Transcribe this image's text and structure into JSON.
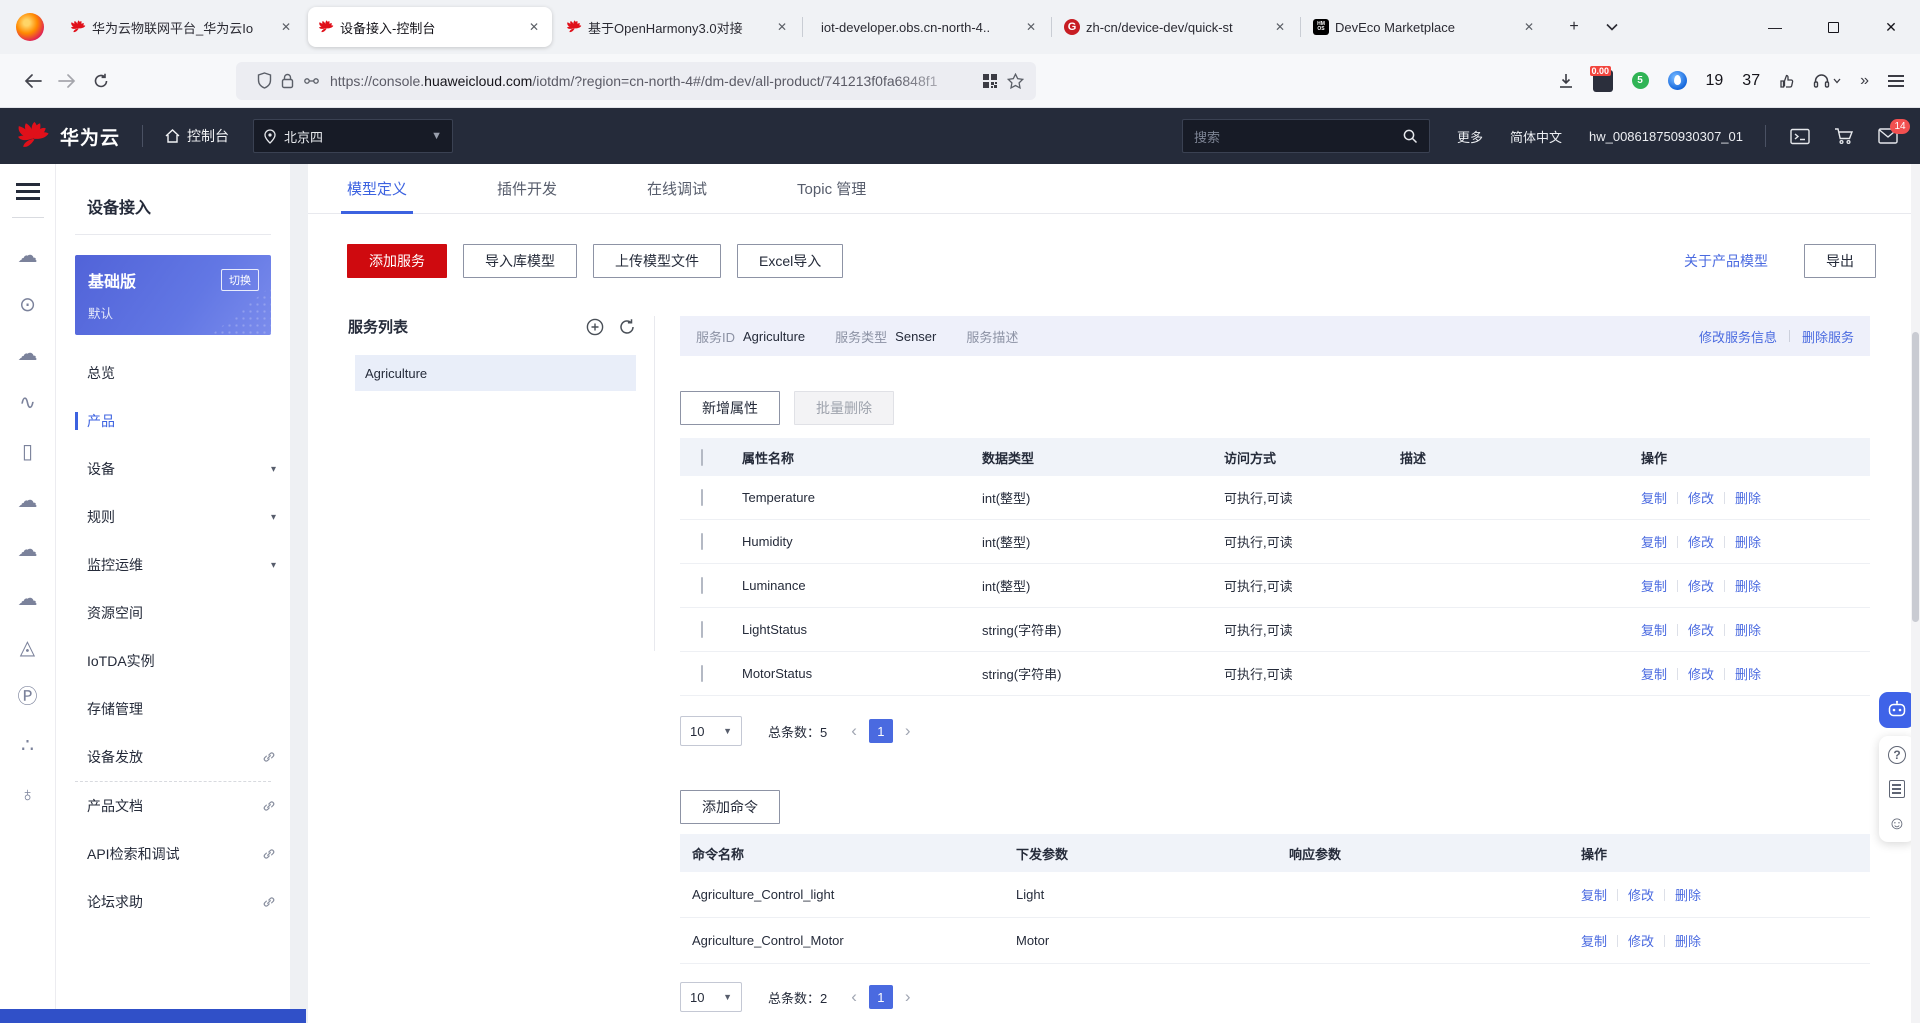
{
  "glyphs": {
    "close": "✕",
    "plus": "+",
    "minus": "—",
    "caret_down": "▾",
    "select_caret": "▼",
    "chevron_left": "‹",
    "chevron_right": "›",
    "more_chevrons": "»",
    "add_circle_plus": "+",
    "smiley": "☺"
  },
  "browser": {
    "tabs": [
      {
        "title": "华为云物联网平台_华为云Io"
      },
      {
        "title": "设备接入-控制台"
      },
      {
        "title": "基于OpenHarmony3.0对接"
      },
      {
        "title": "iot-developer.obs.cn-north-4.."
      },
      {
        "title": "zh-cn/device-dev/quick-st"
      },
      {
        "title": "DevEco Marketplace"
      }
    ],
    "hmos_line1": "HM",
    "hmos_line2": "OS",
    "gitee_letter": "G",
    "url": {
      "prefix": "https://console.",
      "domain": "huaweicloud.com",
      "path": "/iotdm/?region=cn-north-4#/dm-dev/all-product/741213f0fa6848f1"
    },
    "wallet_badge": "0.00",
    "ext_green": "5",
    "ext_counts": [
      "19",
      "37"
    ]
  },
  "console_header": {
    "brand": "华为云",
    "home": "控制台",
    "region": "北京四",
    "search_placeholder": "搜索",
    "more": "更多",
    "lang": "简体中文",
    "account": "hw_008618750930307_01",
    "mail_badge": "14"
  },
  "rail": {
    "icons": [
      {
        "name": "cloud-server-icon",
        "glyph": "☁"
      },
      {
        "name": "cloud-dots-icon",
        "glyph": "⊙"
      },
      {
        "name": "cloud-lines-icon",
        "glyph": "☁"
      },
      {
        "name": "waves-icon",
        "glyph": "∿"
      },
      {
        "name": "device-icon",
        "glyph": "▯"
      },
      {
        "name": "cloud-icon",
        "glyph": "☁"
      },
      {
        "name": "cloud-upload-icon",
        "glyph": "☁"
      },
      {
        "name": "cloud-check-icon",
        "glyph": "☁"
      },
      {
        "name": "drone-icon",
        "glyph": "◬"
      },
      {
        "name": "ip-icon",
        "glyph": "Ⓟ"
      },
      {
        "name": "cluster-icon",
        "glyph": "∴"
      },
      {
        "name": "globe-icon",
        "glyph": "♁"
      }
    ]
  },
  "sidebar": {
    "title": "设备接入",
    "edition": {
      "name": "基础版",
      "switch_label": "切换",
      "subtitle": "默认"
    },
    "items": [
      {
        "label": "总览"
      },
      {
        "label": "产品"
      },
      {
        "label": "设备"
      },
      {
        "label": "规则"
      },
      {
        "label": "监控运维"
      },
      {
        "label": "资源空间"
      },
      {
        "label": "IoTDA实例"
      },
      {
        "label": "存储管理"
      },
      {
        "label": "设备发放"
      },
      {
        "label": "产品文档"
      },
      {
        "label": "API检索和调试"
      },
      {
        "label": "论坛求助"
      }
    ]
  },
  "content": {
    "tabs": [
      {
        "label": "模型定义"
      },
      {
        "label": "插件开发"
      },
      {
        "label": "在线调试"
      },
      {
        "label": "Topic 管理"
      }
    ],
    "toolbar": {
      "add_service": "添加服务",
      "import_model": "导入库模型",
      "upload_model": "上传模型文件",
      "excel_import": "Excel导入",
      "about_link": "关于产品模型",
      "export": "导出"
    },
    "service_list": {
      "title": "服务列表",
      "items": [
        {
          "name": "Agriculture"
        }
      ]
    },
    "service_info": {
      "id_label": "服务ID",
      "id_value": "Agriculture",
      "type_label": "服务类型",
      "type_value": "Senser",
      "desc_label": "服务描述",
      "desc_value": "",
      "edit_link": "修改服务信息",
      "delete_link": "删除服务"
    },
    "row_ops": [
      "复制",
      "修改",
      "删除"
    ],
    "properties": {
      "add_btn": "新增属性",
      "batch_delete_btn": "批量删除",
      "columns": [
        "属性名称",
        "数据类型",
        "访问方式",
        "描述",
        "操作"
      ],
      "rows": [
        {
          "name": "Temperature",
          "type": "int(整型)",
          "access": "可执行,可读",
          "desc": ""
        },
        {
          "name": "Humidity",
          "type": "int(整型)",
          "access": "可执行,可读",
          "desc": ""
        },
        {
          "name": "Luminance",
          "type": "int(整型)",
          "access": "可执行,可读",
          "desc": ""
        },
        {
          "name": "LightStatus",
          "type": "string(字符串)",
          "access": "可执行,可读",
          "desc": ""
        },
        {
          "name": "MotorStatus",
          "type": "string(字符串)",
          "access": "可执行,可读",
          "desc": ""
        }
      ],
      "pagination": {
        "page_size": "10",
        "total_label": "总条数：",
        "total": "5",
        "page": "1"
      }
    },
    "commands": {
      "add_btn": "添加命令",
      "columns": [
        "命令名称",
        "下发参数",
        "响应参数",
        "操作"
      ],
      "rows": [
        {
          "name": "Agriculture_Control_light",
          "param": "Light",
          "response": ""
        },
        {
          "name": "Agriculture_Control_Motor",
          "param": "Motor",
          "response": ""
        }
      ],
      "pagination": {
        "page_size": "10",
        "total_label": "总条数：",
        "total": "2",
        "page": "1"
      }
    }
  }
}
